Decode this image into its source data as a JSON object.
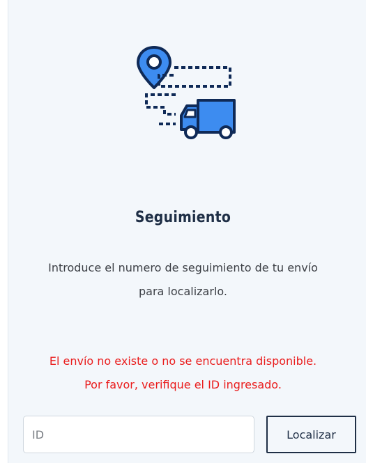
{
  "tracking": {
    "icon": "truck-route-pin-icon",
    "title": "Seguimiento",
    "description_line1": "Introduce el numero de seguimiento de tu envío",
    "description_line2": "para localizarlo.",
    "error_line1": "El envío no existe o no se encuentra disponible.",
    "error_line2": "Por favor, verifique el ID ingresado.",
    "input_placeholder": "ID",
    "input_value": "",
    "button_label": "Localizar"
  },
  "colors": {
    "panel_bg": "#f3f7fb",
    "title": "#1f2f46",
    "error": "#ea1c1c",
    "icon_blue": "#3d8cf0",
    "icon_dark": "#0f2a57"
  }
}
